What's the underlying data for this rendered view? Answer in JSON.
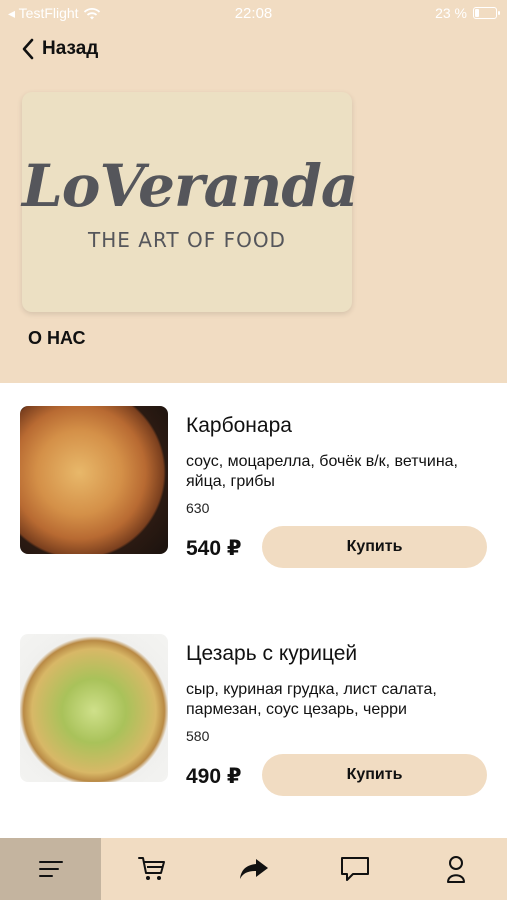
{
  "status_bar": {
    "carrier": "◂ TestFlight",
    "time": "22:08",
    "battery": "23 %",
    "battery_level": 0.23
  },
  "header": {
    "back_label": "Назад"
  },
  "logo": {
    "brand": "LoVeranda",
    "tagline": "THE ART OF FOOD"
  },
  "about_label": "О НАС",
  "products": [
    {
      "name": "Карбонара",
      "description": "соус, моцарелла, бочёк в/к, ветчина, яйца, грибы",
      "weight": "630",
      "price": "540 ₽",
      "buy_label": "Купить"
    },
    {
      "name": "Цезарь с курицей",
      "description": "сыр, куриная грудка, лист салата, пармезан, соус цезарь, черри",
      "weight": "580",
      "price": "490 ₽",
      "buy_label": "Купить"
    }
  ],
  "tabbar": {
    "items": [
      {
        "icon": "menu-icon",
        "active": true
      },
      {
        "icon": "cart-icon",
        "active": false
      },
      {
        "icon": "share-arrow-icon",
        "active": false
      },
      {
        "icon": "chat-icon",
        "active": false
      },
      {
        "icon": "profile-icon",
        "active": false
      }
    ]
  },
  "colors": {
    "accent_beige": "#f1dcc2",
    "active_tab": "#c4b49f",
    "logo_text": "#55565b"
  }
}
